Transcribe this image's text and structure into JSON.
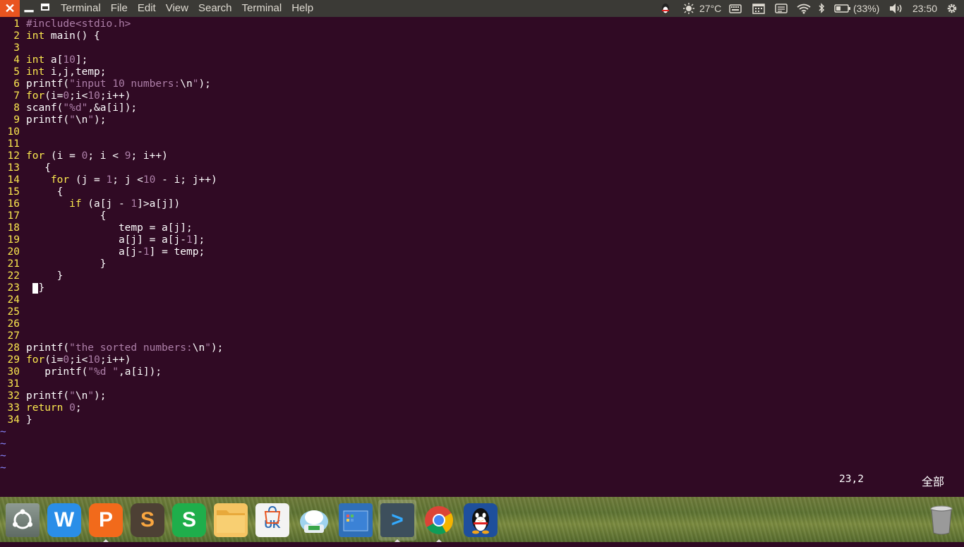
{
  "topbar": {
    "menus": [
      "Terminal",
      "File",
      "Edit",
      "View",
      "Search",
      "Terminal",
      "Help"
    ],
    "weather": "27°C",
    "battery": "(33%)",
    "clock": "23:50"
  },
  "editor": {
    "lines": [
      {
        "n": "1",
        "code": "#include<stdio.h>"
      },
      {
        "n": "2",
        "code": "int main() {"
      },
      {
        "n": "3",
        "code": ""
      },
      {
        "n": "4",
        "code": "int a[10];"
      },
      {
        "n": "5",
        "code": "int i,j,temp;"
      },
      {
        "n": "6",
        "code": "printf(\"input 10 numbers:\\n\");"
      },
      {
        "n": "7",
        "code": "for(i=0;i<10;i++)"
      },
      {
        "n": "8",
        "code": "scanf(\"%d\",&a[i]);"
      },
      {
        "n": "9",
        "code": "printf(\"\\n\");"
      },
      {
        "n": "10",
        "code": ""
      },
      {
        "n": "11",
        "code": ""
      },
      {
        "n": "12",
        "code": "for (i = 0; i < 9; i++)"
      },
      {
        "n": "13",
        "code": "   {"
      },
      {
        "n": "14",
        "code": "    for (j = 1; j <10 - i; j++)"
      },
      {
        "n": "15",
        "code": "     {"
      },
      {
        "n": "16",
        "code": "       if (a[j - 1]>a[j])"
      },
      {
        "n": "17",
        "code": "            {"
      },
      {
        "n": "18",
        "code": "               temp = a[j];"
      },
      {
        "n": "19",
        "code": "               a[j] = a[j-1];"
      },
      {
        "n": "20",
        "code": "               a[j-1] = temp;"
      },
      {
        "n": "21",
        "code": "            }"
      },
      {
        "n": "22",
        "code": "     }"
      },
      {
        "n": "23",
        "code": "  }"
      },
      {
        "n": "24",
        "code": ""
      },
      {
        "n": "25",
        "code": ""
      },
      {
        "n": "26",
        "code": ""
      },
      {
        "n": "27",
        "code": ""
      },
      {
        "n": "28",
        "code": "printf(\"the sorted numbers:\\n\");"
      },
      {
        "n": "29",
        "code": "for(i=0;i<10;i++)"
      },
      {
        "n": "30",
        "code": "   printf(\"%d \",a[i]);"
      },
      {
        "n": "31",
        "code": ""
      },
      {
        "n": "32",
        "code": "printf(\"\\n\");"
      },
      {
        "n": "33",
        "code": "return 0;"
      },
      {
        "n": "34",
        "code": "}"
      }
    ],
    "tilde": "~",
    "status_position": "23,2",
    "status_all": "全部"
  },
  "dock": {
    "items": [
      {
        "name": "dash-home-icon",
        "glyph": ""
      },
      {
        "name": "wps-writer-icon",
        "glyph": "W"
      },
      {
        "name": "wps-presentation-icon",
        "glyph": "P"
      },
      {
        "name": "sublime-text-icon",
        "glyph": "S"
      },
      {
        "name": "wps-spreadsheets-icon",
        "glyph": "S"
      },
      {
        "name": "files-folder-icon",
        "glyph": ""
      },
      {
        "name": "ubuntu-software-uk-icon",
        "glyph": "UK"
      },
      {
        "name": "screenshot-app-icon",
        "glyph": ""
      },
      {
        "name": "workspace-switcher-icon",
        "glyph": ""
      },
      {
        "name": "terminal-icon",
        "glyph": ">"
      },
      {
        "name": "chrome-browser-icon",
        "glyph": ""
      },
      {
        "name": "qq-penguin-icon",
        "glyph": ""
      },
      {
        "name": "trash-icon",
        "glyph": ""
      }
    ]
  },
  "colors": {
    "background": "#300a24",
    "line_numbers": "#fce94f",
    "keywords": "#fce94f",
    "strings_numbers": "#ad7fa8",
    "accent": "#e95420"
  }
}
